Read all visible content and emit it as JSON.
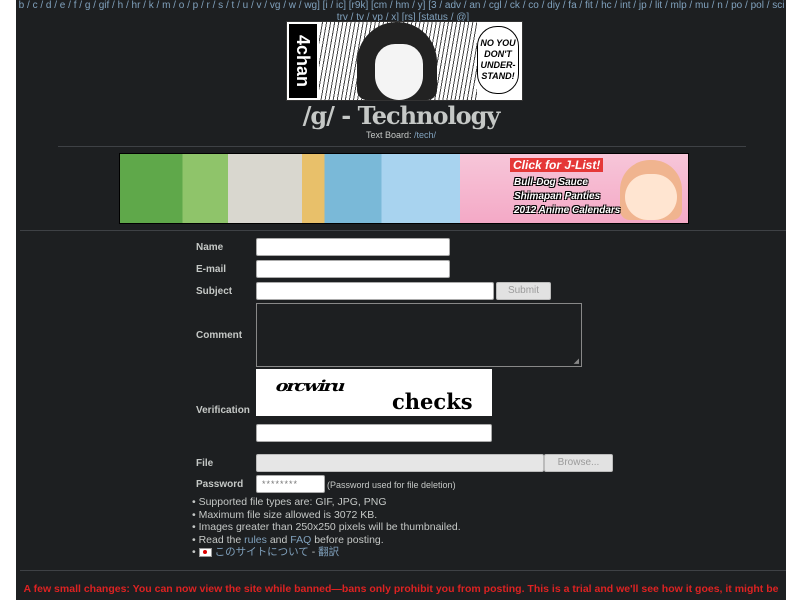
{
  "nav": {
    "line1": "[a / b / c / d / e / f / g / gif / h / hr / k / m / o / p / r / s / t / u / v / vg / w / wg] [i / ic] [r9k] [cm / hm / y] [3 / adv / an / cgl / ck / co / diy / fa / fit / hc / int / jp / lit / mlp / mu / n / po / pol / sci / soc / sp / tg / toy / trv / tv / vp / x] [rs] [status / @]",
    "line2": "trv / tv / vp / x] [rs] [status / @]"
  },
  "logo": {
    "brand": "4chan",
    "bubble": "NO YOU DON'T UNDER-STAND!"
  },
  "board": {
    "title": "/g/ - Technology",
    "subtitle_prefix": "Text Board: ",
    "subtitle_link": "/tech/"
  },
  "banner": {
    "cta": "Click for J-List!",
    "line1": "Bull-Dog Sauce",
    "line2": "Shimapan Panties",
    "line3": "2012 Anime Calendars"
  },
  "form": {
    "name_label": "Name",
    "email_label": "E-mail",
    "subject_label": "Subject",
    "comment_label": "Comment",
    "verification_label": "Verification",
    "file_label": "File",
    "password_label": "Password",
    "submit_label": "Submit",
    "browse_label": "Browse...",
    "password_value": "********",
    "password_note": "(Password used for file deletion)",
    "captcha_word1": "orcwiru",
    "captcha_word2": "checks"
  },
  "rules": {
    "r1": "Supported file types are: GIF, JPG, PNG",
    "r2": "Maximum file size allowed is 3072 KB.",
    "r3": "Images greater than 250x250 pixels will be thumbnailed.",
    "r4_pre": "Read the ",
    "r4_rules": "rules",
    "r4_mid": " and ",
    "r4_faq": "FAQ",
    "r4_post": " before posting.",
    "r5_link": "このサイトについて",
    "r5_sep": " - ",
    "r5_link2": "翻訳"
  },
  "notice": {
    "text": "A few small changes: You can now view the site while banned—bans only prohibit you from posting. This is a trial and we'll see how it goes, it might be"
  },
  "colors": {
    "page_bg": "#1d1f21",
    "text": "#c5c8c6",
    "link": "#81a2be",
    "notice": "#dd2222"
  }
}
